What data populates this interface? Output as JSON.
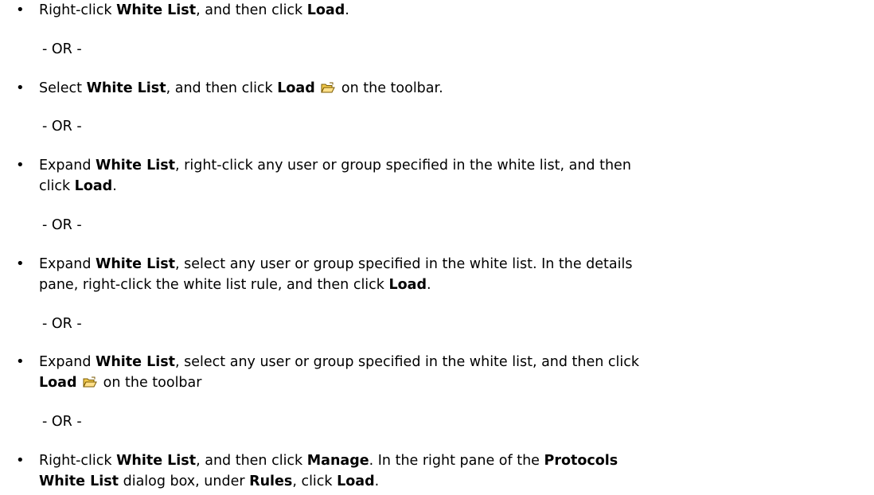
{
  "steps": [
    {
      "segments": [
        "Right-click ",
        "White List",
        ", and then click ",
        "Load",
        "."
      ]
    },
    {
      "segments": [
        "Select ",
        "White List",
        ", and then click ",
        "Load",
        "",
        " on the toolbar."
      ],
      "icon": "open-folder-icon"
    },
    {
      "line1": [
        "Expand ",
        "White List",
        ", right-click any user or group specified in the white list, and then"
      ],
      "line2": [
        "click ",
        "Load",
        "."
      ]
    },
    {
      "line1": [
        "Expand ",
        "White List",
        ", select any user or group specified in the white list. In the details"
      ],
      "line2": [
        "pane, right-click the white list rule, and then click ",
        "Load",
        "."
      ]
    },
    {
      "line1": [
        "Expand ",
        "White List",
        ", select any user or group specified in the white list, and then click"
      ],
      "line2": [
        "Load",
        "",
        " on the toolbar"
      ],
      "icon": "open-folder-icon"
    },
    {
      "line1": [
        "Right-click ",
        "White List",
        ", and then click ",
        "Manage",
        ". In the right pane of the ",
        "Protocols"
      ],
      "line2": [
        "White List",
        " dialog box, under ",
        "Rules",
        ", click ",
        "Load",
        "."
      ]
    }
  ],
  "or_separator": "- OR -",
  "bullet_glyph": "•",
  "colors": {
    "text": "#000000",
    "background": "#ffffff",
    "icon_folder": "#f2c94c",
    "icon_outline": "#7a5a00"
  }
}
